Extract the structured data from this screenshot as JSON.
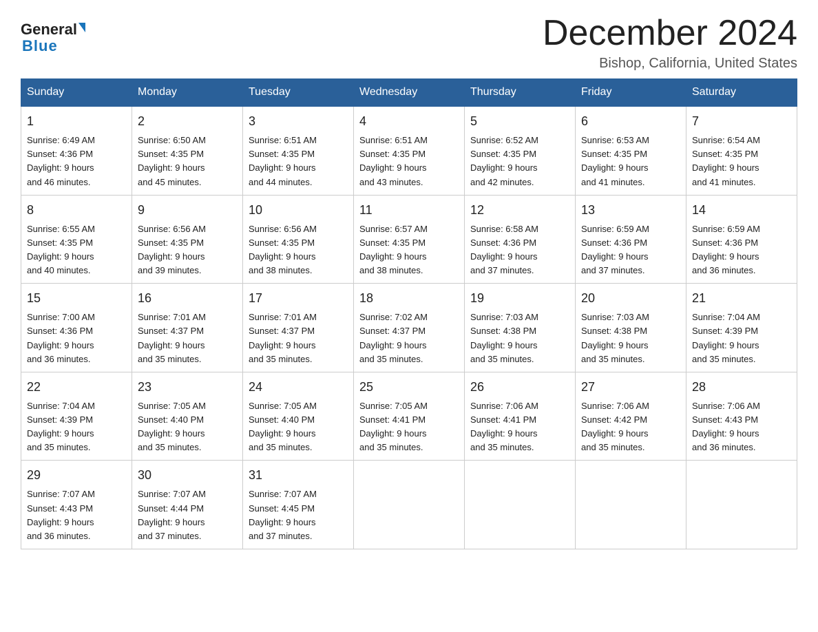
{
  "header": {
    "logo_general": "General",
    "logo_blue": "Blue",
    "title": "December 2024",
    "subtitle": "Bishop, California, United States"
  },
  "weekdays": [
    "Sunday",
    "Monday",
    "Tuesday",
    "Wednesday",
    "Thursday",
    "Friday",
    "Saturday"
  ],
  "weeks": [
    [
      {
        "day": "1",
        "sunrise": "6:49 AM",
        "sunset": "4:36 PM",
        "daylight": "9 hours and 46 minutes."
      },
      {
        "day": "2",
        "sunrise": "6:50 AM",
        "sunset": "4:35 PM",
        "daylight": "9 hours and 45 minutes."
      },
      {
        "day": "3",
        "sunrise": "6:51 AM",
        "sunset": "4:35 PM",
        "daylight": "9 hours and 44 minutes."
      },
      {
        "day": "4",
        "sunrise": "6:51 AM",
        "sunset": "4:35 PM",
        "daylight": "9 hours and 43 minutes."
      },
      {
        "day": "5",
        "sunrise": "6:52 AM",
        "sunset": "4:35 PM",
        "daylight": "9 hours and 42 minutes."
      },
      {
        "day": "6",
        "sunrise": "6:53 AM",
        "sunset": "4:35 PM",
        "daylight": "9 hours and 41 minutes."
      },
      {
        "day": "7",
        "sunrise": "6:54 AM",
        "sunset": "4:35 PM",
        "daylight": "9 hours and 41 minutes."
      }
    ],
    [
      {
        "day": "8",
        "sunrise": "6:55 AM",
        "sunset": "4:35 PM",
        "daylight": "9 hours and 40 minutes."
      },
      {
        "day": "9",
        "sunrise": "6:56 AM",
        "sunset": "4:35 PM",
        "daylight": "9 hours and 39 minutes."
      },
      {
        "day": "10",
        "sunrise": "6:56 AM",
        "sunset": "4:35 PM",
        "daylight": "9 hours and 38 minutes."
      },
      {
        "day": "11",
        "sunrise": "6:57 AM",
        "sunset": "4:35 PM",
        "daylight": "9 hours and 38 minutes."
      },
      {
        "day": "12",
        "sunrise": "6:58 AM",
        "sunset": "4:36 PM",
        "daylight": "9 hours and 37 minutes."
      },
      {
        "day": "13",
        "sunrise": "6:59 AM",
        "sunset": "4:36 PM",
        "daylight": "9 hours and 37 minutes."
      },
      {
        "day": "14",
        "sunrise": "6:59 AM",
        "sunset": "4:36 PM",
        "daylight": "9 hours and 36 minutes."
      }
    ],
    [
      {
        "day": "15",
        "sunrise": "7:00 AM",
        "sunset": "4:36 PM",
        "daylight": "9 hours and 36 minutes."
      },
      {
        "day": "16",
        "sunrise": "7:01 AM",
        "sunset": "4:37 PM",
        "daylight": "9 hours and 35 minutes."
      },
      {
        "day": "17",
        "sunrise": "7:01 AM",
        "sunset": "4:37 PM",
        "daylight": "9 hours and 35 minutes."
      },
      {
        "day": "18",
        "sunrise": "7:02 AM",
        "sunset": "4:37 PM",
        "daylight": "9 hours and 35 minutes."
      },
      {
        "day": "19",
        "sunrise": "7:03 AM",
        "sunset": "4:38 PM",
        "daylight": "9 hours and 35 minutes."
      },
      {
        "day": "20",
        "sunrise": "7:03 AM",
        "sunset": "4:38 PM",
        "daylight": "9 hours and 35 minutes."
      },
      {
        "day": "21",
        "sunrise": "7:04 AM",
        "sunset": "4:39 PM",
        "daylight": "9 hours and 35 minutes."
      }
    ],
    [
      {
        "day": "22",
        "sunrise": "7:04 AM",
        "sunset": "4:39 PM",
        "daylight": "9 hours and 35 minutes."
      },
      {
        "day": "23",
        "sunrise": "7:05 AM",
        "sunset": "4:40 PM",
        "daylight": "9 hours and 35 minutes."
      },
      {
        "day": "24",
        "sunrise": "7:05 AM",
        "sunset": "4:40 PM",
        "daylight": "9 hours and 35 minutes."
      },
      {
        "day": "25",
        "sunrise": "7:05 AM",
        "sunset": "4:41 PM",
        "daylight": "9 hours and 35 minutes."
      },
      {
        "day": "26",
        "sunrise": "7:06 AM",
        "sunset": "4:41 PM",
        "daylight": "9 hours and 35 minutes."
      },
      {
        "day": "27",
        "sunrise": "7:06 AM",
        "sunset": "4:42 PM",
        "daylight": "9 hours and 35 minutes."
      },
      {
        "day": "28",
        "sunrise": "7:06 AM",
        "sunset": "4:43 PM",
        "daylight": "9 hours and 36 minutes."
      }
    ],
    [
      {
        "day": "29",
        "sunrise": "7:07 AM",
        "sunset": "4:43 PM",
        "daylight": "9 hours and 36 minutes."
      },
      {
        "day": "30",
        "sunrise": "7:07 AM",
        "sunset": "4:44 PM",
        "daylight": "9 hours and 37 minutes."
      },
      {
        "day": "31",
        "sunrise": "7:07 AM",
        "sunset": "4:45 PM",
        "daylight": "9 hours and 37 minutes."
      },
      null,
      null,
      null,
      null
    ]
  ],
  "labels": {
    "sunrise": "Sunrise:",
    "sunset": "Sunset:",
    "daylight": "Daylight:"
  }
}
